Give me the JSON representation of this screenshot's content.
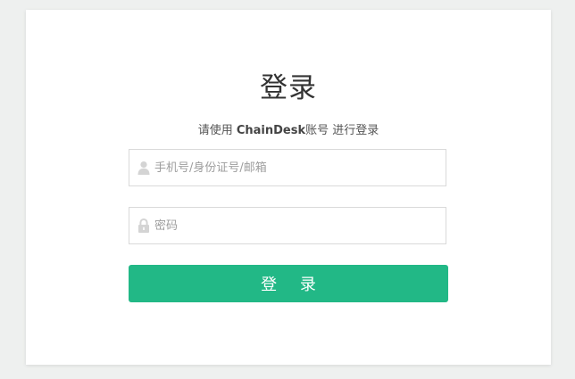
{
  "login": {
    "title": "登录",
    "subtitle_prefix": "请使用 ",
    "subtitle_brand": "ChainDesk",
    "subtitle_suffix": "账号 进行登录",
    "account_placeholder": "手机号/身份证号/邮箱",
    "account_value": "",
    "password_placeholder": "密码",
    "password_value": "",
    "submit_label": "登 录"
  },
  "icons": {
    "account": "user-icon",
    "password": "lock-icon"
  },
  "colors": {
    "background": "#eef0ef",
    "card": "#ffffff",
    "accent": "#22b886",
    "placeholder": "#9e9e9e",
    "icon": "#d4d4d4"
  }
}
